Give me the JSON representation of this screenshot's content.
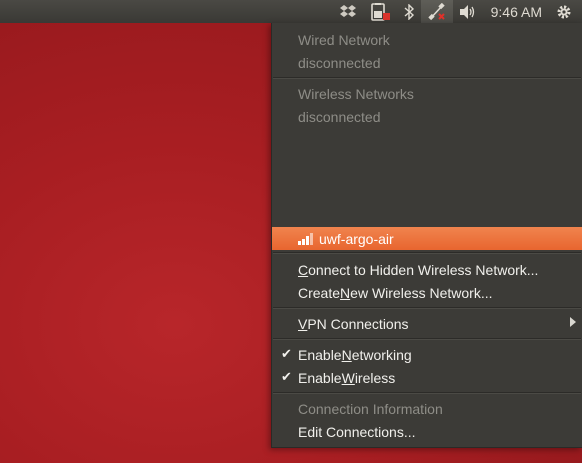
{
  "panel": {
    "clock": "9:46 AM"
  },
  "menu": {
    "wired_header": "Wired Network",
    "wired_status": "disconnected",
    "wireless_header": "Wireless Networks",
    "wireless_status": "disconnected",
    "network_ssid": "uwf-argo-air",
    "hidden_network_pre": "",
    "hidden_network_ul": "C",
    "hidden_network_post": "onnect to Hidden Wireless Network...",
    "new_network_pre": "Create ",
    "new_network_ul": "N",
    "new_network_post": "ew Wireless Network...",
    "vpn_pre": "",
    "vpn_ul": "V",
    "vpn_post": "PN Connections",
    "enable_networking_pre": "Enable ",
    "enable_networking_ul": "N",
    "enable_networking_post": "etworking",
    "enable_wireless_pre": "Enable ",
    "enable_wireless_ul": "W",
    "enable_wireless_post": "ireless",
    "connection_info": "Connection Information",
    "edit_connections": "Edit Connections...",
    "check_mark": "✔"
  },
  "colors": {
    "highlight": "#e8652f",
    "menu_bg": "#3c3b37",
    "disabled_text": "#8e8d87"
  }
}
